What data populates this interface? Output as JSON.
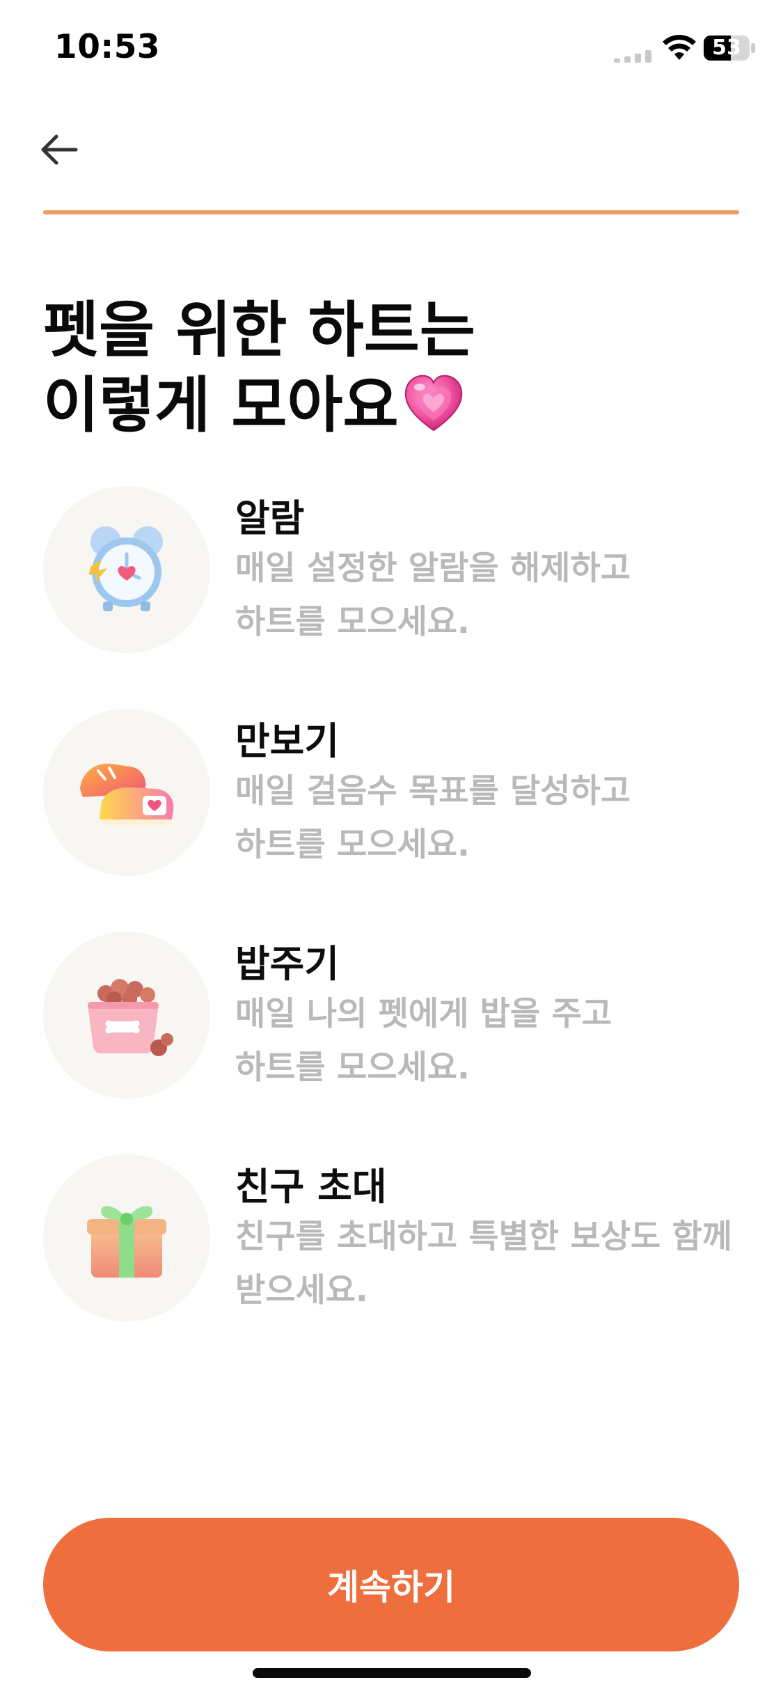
{
  "status_bar": {
    "time": "10:53",
    "battery": "53",
    "icons": [
      "signal-icon",
      "wifi-icon",
      "battery-icon"
    ]
  },
  "header": {
    "back_icon": "arrow-left-icon",
    "progress": 1.0,
    "progress_color": "#ee9a62"
  },
  "title": {
    "line1": "펫을 위한 하트는",
    "line2": "이렇게 모아요",
    "emoji": "sparkling-heart-icon"
  },
  "features": [
    {
      "title": "알람",
      "desc_line1": "매일 설정한 알람을 해제하고",
      "desc_line2": "하트를 모으세요.",
      "icon": "alarm-clock-icon"
    },
    {
      "title": "만보기",
      "desc_line1": "매일 걸음수 목표를 달성하고",
      "desc_line2": "하트를 모으세요.",
      "icon": "sneakers-icon"
    },
    {
      "title": "밥주기",
      "desc_line1": "매일 나의 펫에게 밥을 주고",
      "desc_line2": "하트를 모으세요.",
      "icon": "pet-food-bowl-icon"
    },
    {
      "title": "친구 초대",
      "desc_line1": "친구를 초대하고 특별한 보상도 함께",
      "desc_line2": "받으세요.",
      "icon": "gift-box-icon"
    }
  ],
  "continue_button": {
    "label": "계속하기",
    "color": "#ee6e3e"
  }
}
